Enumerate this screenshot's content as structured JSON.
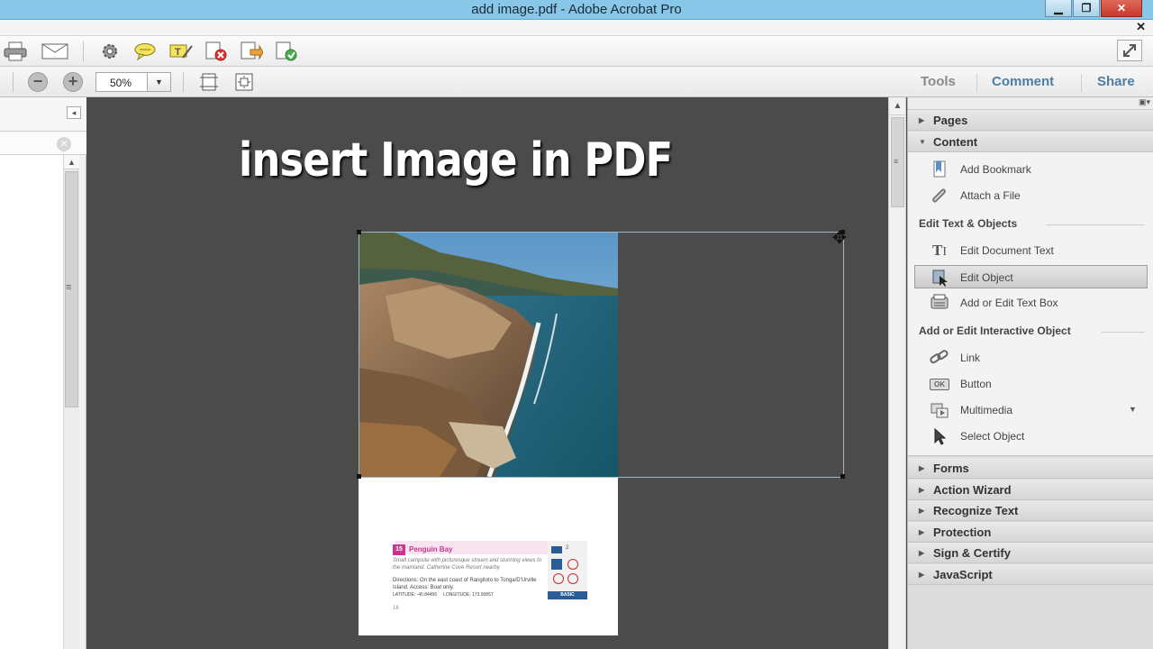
{
  "window": {
    "title": "add image.pdf - Adobe Acrobat Pro",
    "minimize": "▁",
    "maximize": "❐",
    "close": "✕",
    "doc_close": "✕"
  },
  "toolbar": {
    "icons": [
      "printer-icon",
      "email-icon",
      "gear-icon",
      "comment-bubble-icon",
      "highlight-text-icon",
      "reject-icon",
      "send-for-review-icon",
      "export-icon",
      "full-screen-icon"
    ]
  },
  "zoom": {
    "value": "50%",
    "zoom_out": "−",
    "zoom_in": "+",
    "dropdown_arrow": "▼"
  },
  "tabs": {
    "tools": "Tools",
    "comment": "Comment",
    "share": "Share"
  },
  "overlay": {
    "title": "insert Image in PDF"
  },
  "card": {
    "number": "15",
    "title": "Penguin Bay",
    "description": "Small campsite with picturesque stream and stunning views to the mainland. Catherine Cove Resort nearby.",
    "directions": "Directions: On the east coast of Rangitoto to Tonga/D'Urville Island. Access: Boat only.",
    "latitude": "LATITUDE: -40.84456",
    "longitude": "LONGITUDE: 173.90857",
    "badge": "BASIC",
    "count": "2",
    "page_footer": "16"
  },
  "right_panel": {
    "pages": "Pages",
    "content": "Content",
    "items_top": [
      {
        "label": "Add Bookmark",
        "icon": "bookmark-icon"
      },
      {
        "label": "Attach a File",
        "icon": "paperclip-icon"
      }
    ],
    "group_edit": "Edit Text & Objects",
    "items_edit": [
      {
        "label": "Edit Document Text",
        "icon": "text-edit-icon"
      },
      {
        "label": "Edit Object",
        "icon": "edit-object-icon"
      },
      {
        "label": "Add or Edit Text Box",
        "icon": "typewriter-icon"
      }
    ],
    "group_interactive": "Add or Edit Interactive Object",
    "items_interactive": [
      {
        "label": "Link",
        "icon": "link-icon"
      },
      {
        "label": "Button",
        "icon": "ok-button-icon",
        "glyph": "OK"
      },
      {
        "label": "Multimedia",
        "icon": "multimedia-icon"
      },
      {
        "label": "Select Object",
        "icon": "pointer-icon"
      }
    ],
    "sections": [
      "Forms",
      "Action Wizard",
      "Recognize Text",
      "Protection",
      "Sign & Certify",
      "JavaScript"
    ]
  }
}
